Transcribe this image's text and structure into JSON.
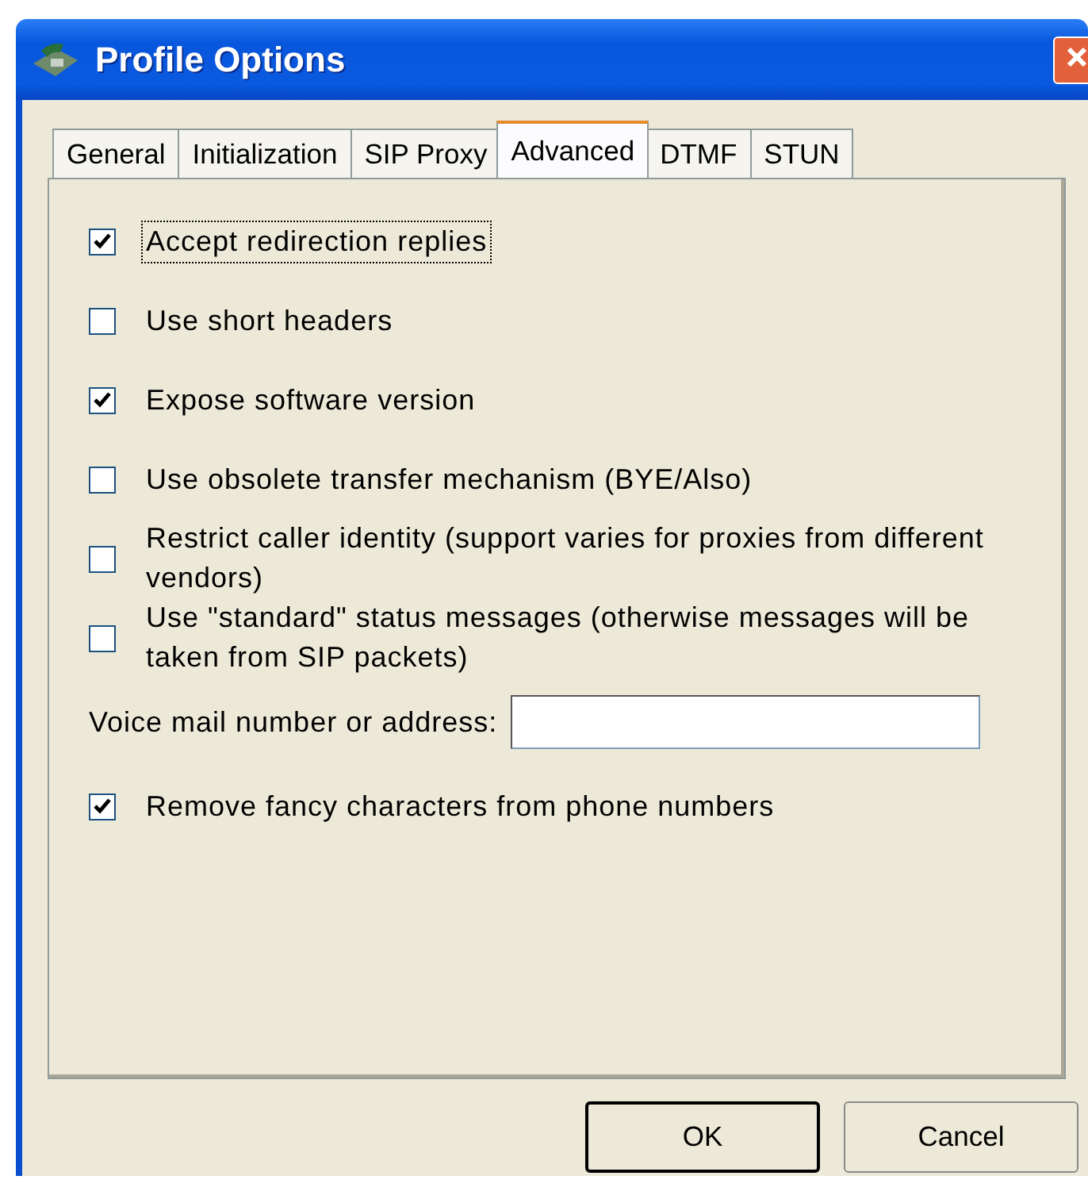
{
  "window": {
    "title": "Profile Options"
  },
  "tabs": [
    {
      "label": "General",
      "selected": false
    },
    {
      "label": "Initialization",
      "selected": false
    },
    {
      "label": "SIP Proxy",
      "selected": false
    },
    {
      "label": "Advanced",
      "selected": true
    },
    {
      "label": "DTMF",
      "selected": false
    },
    {
      "label": "STUN",
      "selected": false
    }
  ],
  "options": [
    {
      "kind": "checkbox",
      "label": "Accept redirection replies",
      "checked": true,
      "focused": true
    },
    {
      "kind": "checkbox",
      "label": "Use short headers",
      "checked": false,
      "focused": false
    },
    {
      "kind": "checkbox",
      "label": "Expose software version",
      "checked": true,
      "focused": false
    },
    {
      "kind": "checkbox",
      "label": "Use obsolete transfer mechanism (BYE/Also)",
      "checked": false,
      "focused": false
    },
    {
      "kind": "checkbox",
      "label": "Restrict caller identity (support varies for proxies from different vendors)",
      "checked": false,
      "focused": false
    },
    {
      "kind": "checkbox",
      "label": "Use \"standard\" status messages (otherwise messages will be taken from SIP packets)",
      "checked": false,
      "focused": false
    },
    {
      "kind": "field",
      "label": "Voice mail number or address:"
    },
    {
      "kind": "checkbox",
      "label": "Remove fancy characters from phone numbers",
      "checked": true,
      "focused": false
    }
  ],
  "buttons": [
    {
      "label": "OK",
      "default": true
    },
    {
      "label": "Cancel",
      "default": false
    }
  ]
}
